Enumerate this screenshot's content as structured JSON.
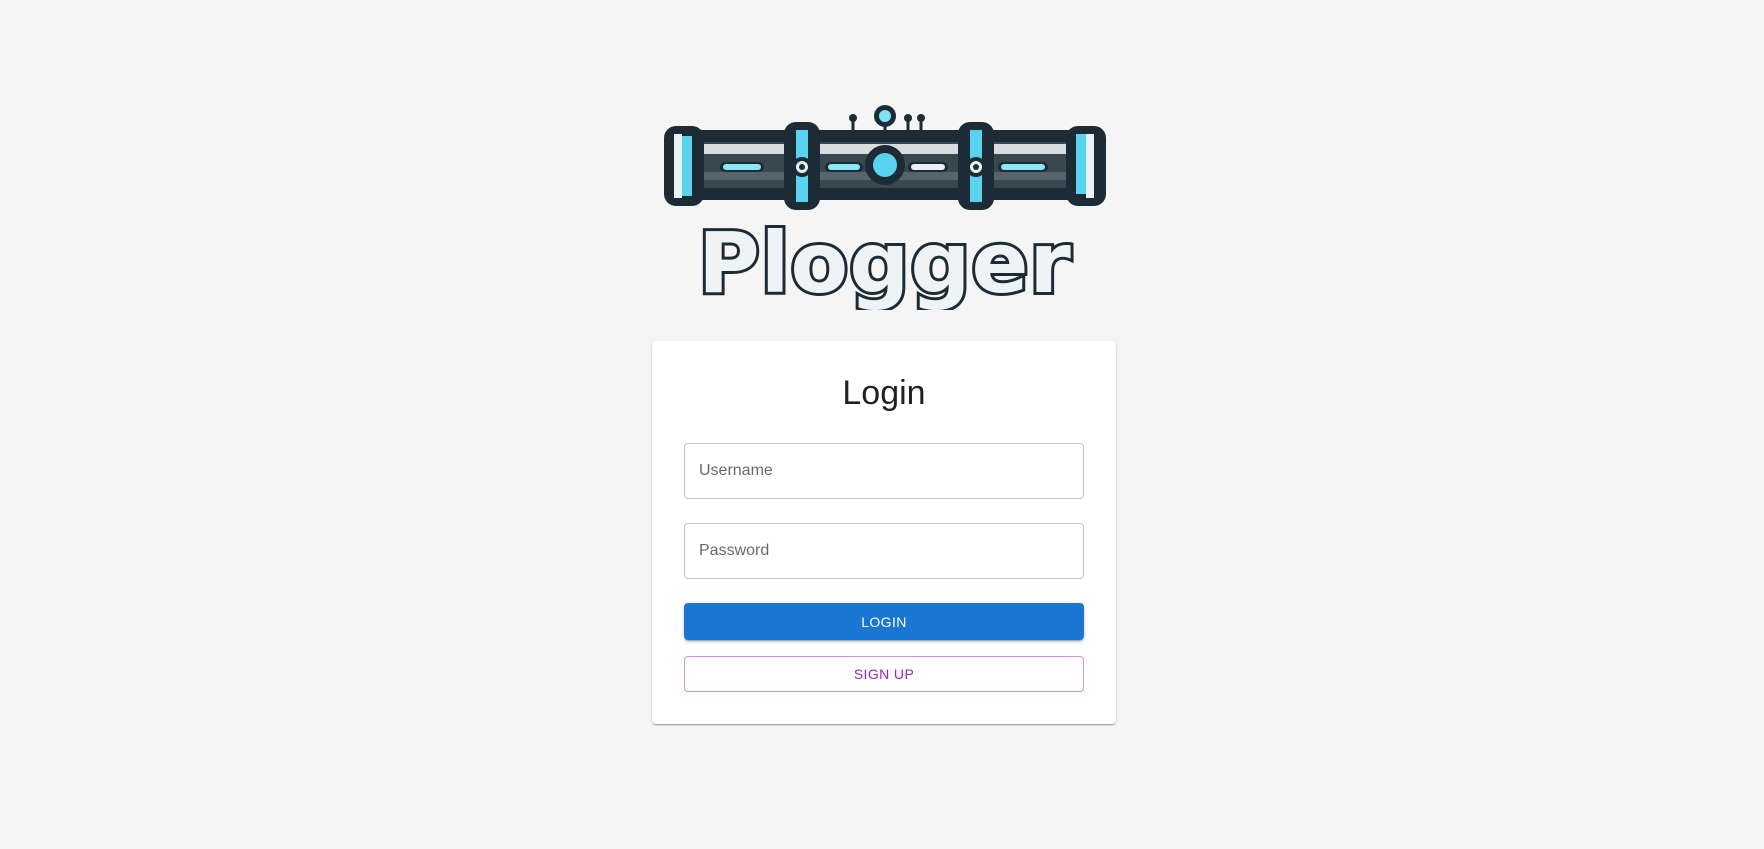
{
  "app": {
    "logo_text": "Plogger"
  },
  "login_form": {
    "title": "Login",
    "username_placeholder": "Username",
    "password_placeholder": "Password",
    "login_button_label": "LOGIN",
    "signup_button_label": "SIGN UP"
  },
  "colors": {
    "background": "#f5f5f5",
    "primary": "#1976d2",
    "secondary": "#9c27b0",
    "logo_accent": "#5ad4ee",
    "logo_outline": "#1c2b36"
  }
}
